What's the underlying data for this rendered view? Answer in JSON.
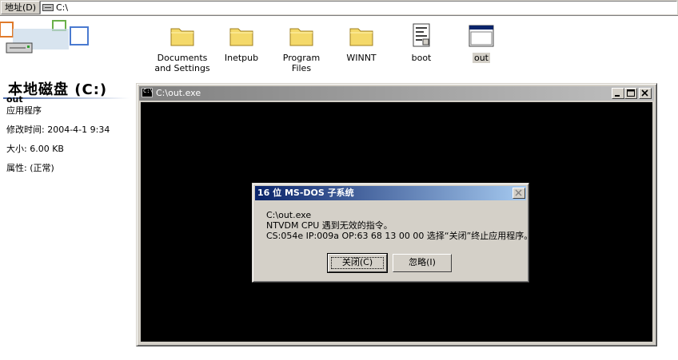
{
  "address_bar": {
    "label": "地址(D)",
    "path": "C:\\"
  },
  "banner": {
    "title": "本地磁盘 (C:)"
  },
  "files": [
    {
      "line1": "Documents",
      "line2": "and Settings",
      "type": "folder"
    },
    {
      "line1": "Inetpub",
      "line2": "",
      "type": "folder"
    },
    {
      "line1": "Program Files",
      "line2": "",
      "type": "folder"
    },
    {
      "line1": "WINNT",
      "line2": "",
      "type": "folder"
    },
    {
      "line1": "boot",
      "line2": "",
      "type": "ini-file"
    },
    {
      "line1": "out",
      "line2": "",
      "type": "exe-window",
      "selected": true
    }
  ],
  "details": {
    "name": "out",
    "type": "应用程序",
    "modified": "修改时间: 2004-4-1 9:34",
    "size": "大小: 6.00 KB",
    "attributes": "属性: (正常)"
  },
  "console": {
    "title": "C:\\out.exe"
  },
  "dialog": {
    "title": "16 位 MS-DOS 子系统",
    "message_line1": "C:\\out.exe",
    "message_line2": "NTVDM CPU 遇到无效的指令。",
    "message_line3": "CS:054e IP:009a OP:63 68 13 00 00 选择“关闭”终止应用程序。",
    "close_button": "关闭(C)",
    "ignore_button": "忽略(I)"
  },
  "colors": {
    "window_face": "#d4d0c8",
    "active_title_start": "#0a246a",
    "active_title_end": "#a6caf0",
    "inactive_title": "#808080",
    "folder_yellow": "#f4d96a"
  }
}
